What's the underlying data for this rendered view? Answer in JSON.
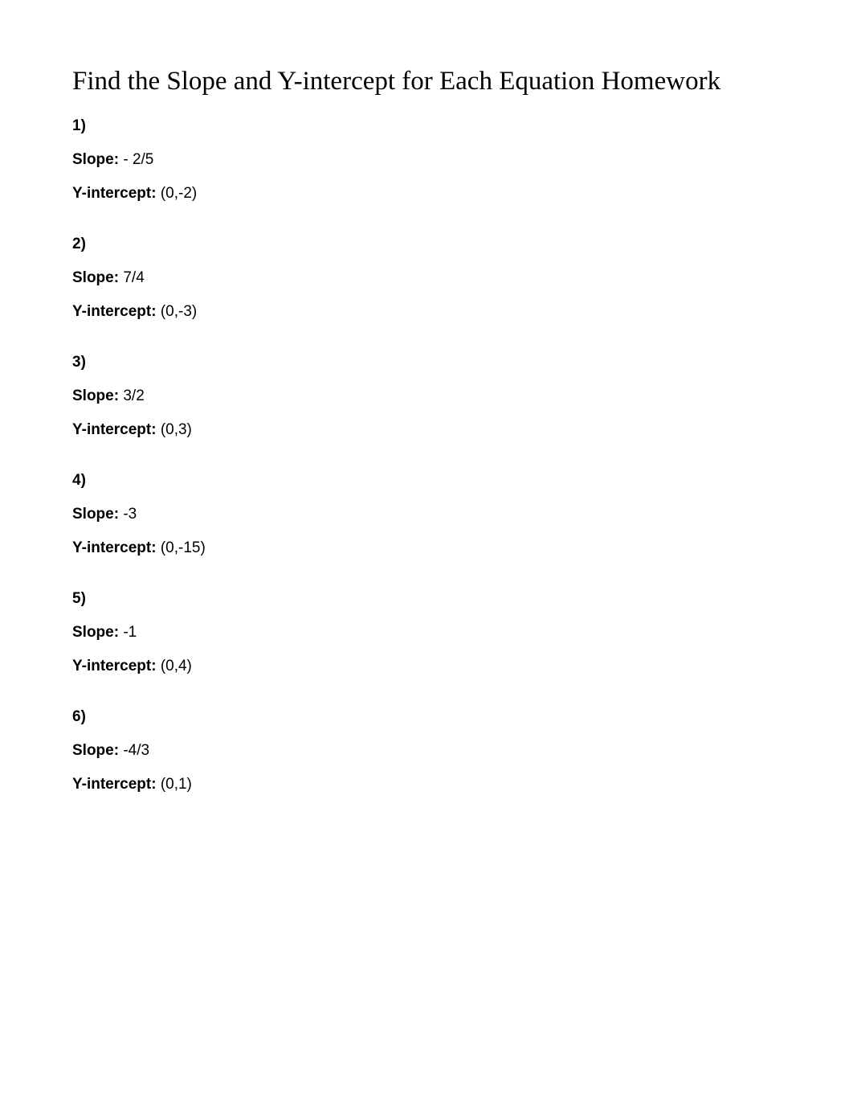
{
  "title": "Find the Slope and Y-intercept for Each Equation Homework",
  "labels": {
    "slope": "Slope:",
    "yintercept": "Y-intercept:"
  },
  "problems": [
    {
      "number": "1)",
      "slope": "- 2/5",
      "yintercept": "(0,-2)"
    },
    {
      "number": "2)",
      "slope": "7/4",
      "yintercept": "(0,-3)"
    },
    {
      "number": "3)",
      "slope": "3/2",
      "yintercept": "(0,3)"
    },
    {
      "number": "4)",
      "slope": "-3",
      "yintercept": "(0,-15)"
    },
    {
      "number": "5)",
      "slope": "-1",
      "yintercept": "(0,4)"
    },
    {
      "number": "6)",
      "slope": "-4/3",
      "yintercept": "(0,1)"
    }
  ],
  "divider_char_count": 127
}
